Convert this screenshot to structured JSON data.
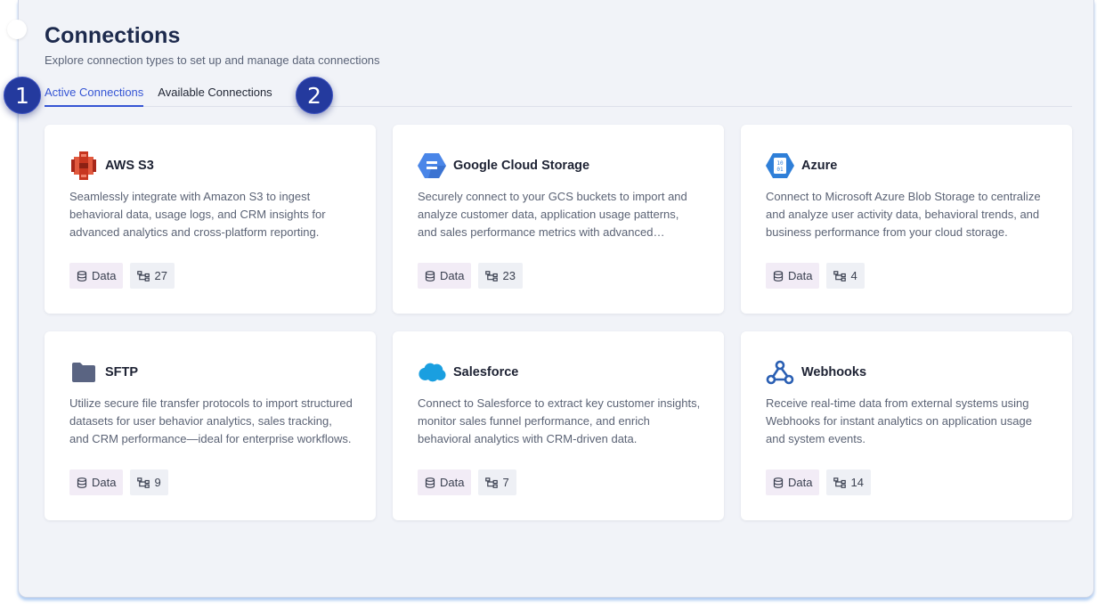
{
  "page": {
    "title": "Connections",
    "subtitle": "Explore connection types to set up and manage data connections"
  },
  "tabs": [
    {
      "label": "Active Connections",
      "active": true
    },
    {
      "label": "Available Connections",
      "active": false
    }
  ],
  "badges": [
    "1",
    "2"
  ],
  "cards": [
    {
      "name": "AWS S3",
      "icon": "aws-s3-icon",
      "description": "Seamlessly integrate with Amazon S3 to ingest behavioral data, usage logs, and CRM insights for advanced analytics and cross-platform reporting.",
      "data_label": "Data",
      "count": "27"
    },
    {
      "name": "Google Cloud Storage",
      "icon": "google-cloud-storage-icon",
      "description": "Securely connect to your GCS buckets to import and analyze customer data, application usage patterns, and sales performance metrics with advanced analytics.",
      "data_label": "Data",
      "count": "23"
    },
    {
      "name": "Azure",
      "icon": "azure-blob-icon",
      "description": "Connect to Microsoft Azure Blob Storage to centralize and analyze user activity data, behavioral trends, and business performance from your cloud storage.",
      "data_label": "Data",
      "count": "4"
    },
    {
      "name": "SFTP",
      "icon": "folder-icon",
      "description": "Utilize secure file transfer protocols to import structured datasets for user behavior analytics, sales tracking, and CRM performance—ideal for enterprise workflows.",
      "data_label": "Data",
      "count": "9"
    },
    {
      "name": "Salesforce",
      "icon": "salesforce-cloud-icon",
      "description": "Connect to Salesforce to extract key customer insights, monitor sales funnel performance, and enrich behavioral analytics with CRM-driven data.",
      "data_label": "Data",
      "count": "7"
    },
    {
      "name": "Webhooks",
      "icon": "webhooks-icon",
      "description": "Receive real-time data from external systems using Webhooks for instant analytics on application usage and system events.",
      "data_label": "Data",
      "count": "14"
    }
  ],
  "colors": {
    "accent": "#3555d4",
    "badge": "#243a9e",
    "aws": "#d9452d",
    "gcs": "#4a86e8",
    "azure": "#2f7fd8",
    "sftp": "#5a6482",
    "salesforce": "#1a9fe0",
    "webhooks": "#2a5fb3"
  }
}
